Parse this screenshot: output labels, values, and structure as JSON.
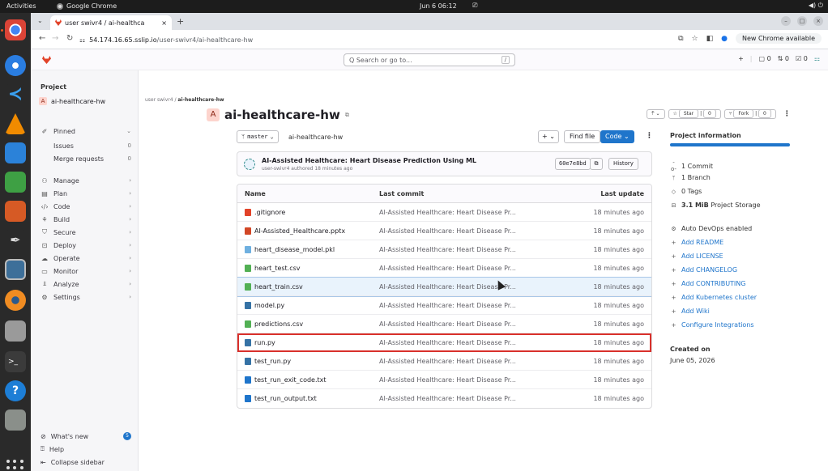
{
  "os": {
    "activities": "Activities",
    "app_name": "Google Chrome",
    "clock": "Jun 6  06:12"
  },
  "browser": {
    "tab_title": "user swivr4 / ai-healthca",
    "url_host": "54.174.16.65.sslip.io",
    "url_path": "/user-swivr4/ai-healthcare-hw",
    "new_chrome": "New Chrome available"
  },
  "gitlab": {
    "search_placeholder": "Q Search or go to...",
    "search_kbd": "/",
    "header_counts": [
      "0",
      "0",
      "0"
    ]
  },
  "sidebar": {
    "section": "Project",
    "project_initial": "A",
    "project_name": "ai-healthcare-hw",
    "pinned": {
      "label": "Pinned",
      "icon": "pin-icon"
    },
    "pinned_items": [
      {
        "label": "Issues",
        "count": "0"
      },
      {
        "label": "Merge requests",
        "count": "0"
      }
    ],
    "items": [
      {
        "label": "Manage",
        "icon": "users-icon"
      },
      {
        "label": "Plan",
        "icon": "plan-icon"
      },
      {
        "label": "Code",
        "icon": "code-icon"
      },
      {
        "label": "Build",
        "icon": "rocket-icon"
      },
      {
        "label": "Secure",
        "icon": "shield-icon"
      },
      {
        "label": "Deploy",
        "icon": "deploy-icon"
      },
      {
        "label": "Operate",
        "icon": "cloud-icon"
      },
      {
        "label": "Monitor",
        "icon": "monitor-icon"
      },
      {
        "label": "Analyze",
        "icon": "chart-icon"
      },
      {
        "label": "Settings",
        "icon": "gear-icon"
      }
    ],
    "whats_new": "What's new",
    "whats_new_count": "5",
    "help": "Help",
    "collapse": "Collapse sidebar"
  },
  "main": {
    "breadcrumb_user": "user swivr4",
    "breadcrumb_sep": "/",
    "breadcrumb_project": "ai-healthcare-hw",
    "project_initial": "A",
    "project_title": "ai-healthcare-hw",
    "star_label": "Star",
    "star_count": "0",
    "fork_label": "Fork",
    "fork_count": "0",
    "branch": "master",
    "repo_path": "ai-healthcare-hw",
    "plus": "+",
    "find_file": "Find file",
    "code_btn": "Code",
    "commit": {
      "message": "AI-Assisted Healthcare: Heart Disease Prediction Using ML",
      "author": "user-swivr4 authored 18 minutes ago",
      "sha": "60e7e8bd",
      "history": "History"
    },
    "table": {
      "headers": [
        "Name",
        "Last commit",
        "Last update"
      ],
      "rows": [
        {
          "name": ".gitignore",
          "commit": "AI-Assisted Healthcare: Heart Disease Pr...",
          "updated": "18 minutes ago",
          "icon": "git-icon",
          "color": "#e24329"
        },
        {
          "name": "AI-Assisted_Healthcare.pptx",
          "commit": "AI-Assisted Healthcare: Heart Disease Pr...",
          "updated": "18 minutes ago",
          "icon": "pptx-icon",
          "color": "#d24726"
        },
        {
          "name": "heart_disease_model.pkl",
          "commit": "AI-Assisted Healthcare: Heart Disease Pr...",
          "updated": "18 minutes ago",
          "icon": "file-icon",
          "color": "#6fb0e0"
        },
        {
          "name": "heart_test.csv",
          "commit": "AI-Assisted Healthcare: Heart Disease Pr...",
          "updated": "18 minutes ago",
          "icon": "csv-icon",
          "color": "#52b054"
        },
        {
          "name": "heart_train.csv",
          "commit": "AI-Assisted Healthcare: Heart Disease Pr...",
          "updated": "18 minutes ago",
          "icon": "csv-icon",
          "color": "#52b054"
        },
        {
          "name": "model.py",
          "commit": "AI-Assisted Healthcare: Heart Disease Pr...",
          "updated": "18 minutes ago",
          "icon": "python-icon",
          "color": "#3572a5"
        },
        {
          "name": "predictions.csv",
          "commit": "AI-Assisted Healthcare: Heart Disease Pr...",
          "updated": "18 minutes ago",
          "icon": "csv-icon",
          "color": "#52b054"
        },
        {
          "name": "run.py",
          "commit": "AI-Assisted Healthcare: Heart Disease Pr...",
          "updated": "18 minutes ago",
          "icon": "python-icon",
          "color": "#3572a5"
        },
        {
          "name": "test_run.py",
          "commit": "AI-Assisted Healthcare: Heart Disease Pr...",
          "updated": "18 minutes ago",
          "icon": "python-icon",
          "color": "#3572a5"
        },
        {
          "name": "test_run_exit_code.txt",
          "commit": "AI-Assisted Healthcare: Heart Disease Pr...",
          "updated": "18 minutes ago",
          "icon": "text-icon",
          "color": "#1f75cb"
        },
        {
          "name": "test_run_output.txt",
          "commit": "AI-Assisted Healthcare: Heart Disease Pr...",
          "updated": "18 minutes ago",
          "icon": "text-icon",
          "color": "#1f75cb"
        }
      ]
    }
  },
  "info": {
    "title": "Project information",
    "commits": "1 Commit",
    "branches": "1 Branch",
    "tags": "0 Tags",
    "storage_value": "3.1 MiB",
    "storage_label": "Project Storage",
    "auto_devops": "Auto DevOps enabled",
    "links": [
      "Add README",
      "Add LICENSE",
      "Add CHANGELOG",
      "Add CONTRIBUTING",
      "Add Kubernetes cluster",
      "Add Wiki",
      "Configure Integrations"
    ],
    "created_on": "Created on",
    "created_date": "June 05, 2026"
  }
}
